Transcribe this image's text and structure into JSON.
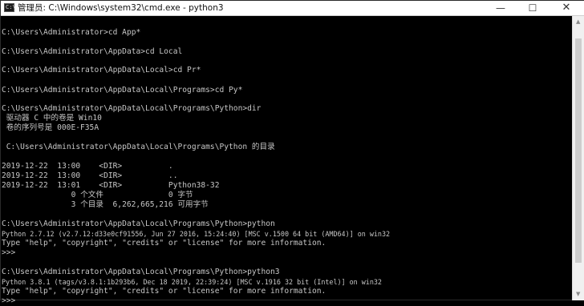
{
  "window": {
    "title": "管理员: C:\\Windows\\system32\\cmd.exe - python3",
    "icon": "cmd-icon",
    "icon_glyph": "C:\\",
    "minimize_glyph": "—",
    "maximize_glyph": "☐",
    "close_glyph": "✕"
  },
  "console": {
    "lines": [
      "C:\\Users\\Administrator>cd App*",
      "C:\\Users\\Administrator\\AppData>cd Local",
      "C:\\Users\\Administrator\\AppData\\Local>cd Pr*",
      "C:\\Users\\Administrator\\AppData\\Local\\Programs>cd Py*",
      "C:\\Users\\Administrator\\AppData\\Local\\Programs\\Python>dir",
      " 驱动器 C 中的卷是 Win10",
      " 卷的序列号是 000E-F35A",
      " C:\\Users\\Administrator\\AppData\\Local\\Programs\\Python 的目录",
      "2019-12-22  13:00    <DIR>          .",
      "2019-12-22  13:00    <DIR>          ..",
      "2019-12-22  13:01    <DIR>          Python38-32",
      "               0 个文件              0 字节",
      "               3 个目录  6,262,665,216 可用字节",
      "C:\\Users\\Administrator\\AppData\\Local\\Programs\\Python>python",
      "Python 2.7.12 (v2.7.12:d33e0cf91556, Jun 27 2016, 15:24:40) [MSC v.1500 64 bit (AMD64)] on win32",
      "Type \"help\", \"copyright\", \"credits\" or \"license\" for more information.",
      ">>>",
      "C:\\Users\\Administrator\\AppData\\Local\\Programs\\Python>python3",
      "Python 3.8.1 (tags/v3.8.1:1b293b6, Dec 18 2019, 22:39:24) [MSC v.1916 32 bit (Intel)] on win32",
      "Type \"help\", \"copyright\", \"credits\" or \"license\" for more information.",
      ">>>"
    ]
  },
  "scrollbar": {
    "up_glyph": "▲",
    "down_glyph": "▼"
  }
}
